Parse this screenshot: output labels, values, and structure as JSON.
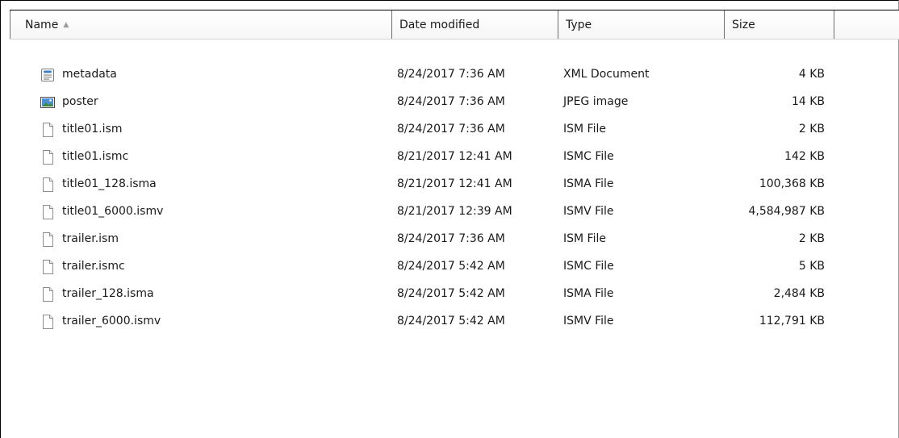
{
  "columns": {
    "name": "Name",
    "date": "Date modified",
    "type": "Type",
    "size": "Size"
  },
  "sort": {
    "column": "name",
    "direction": "ascending",
    "indicator": "▲"
  },
  "files": [
    {
      "name": "metadata",
      "date": "8/24/2017 7:36 AM",
      "type": "XML Document",
      "size": "4 KB",
      "icon": "xml-document-icon"
    },
    {
      "name": "poster",
      "date": "8/24/2017 7:36 AM",
      "type": "JPEG image",
      "size": "14 KB",
      "icon": "image-file-icon"
    },
    {
      "name": "title01.ism",
      "date": "8/24/2017 7:36 AM",
      "type": "ISM File",
      "size": "2 KB",
      "icon": "blank-file-icon"
    },
    {
      "name": "title01.ismc",
      "date": "8/21/2017 12:41 AM",
      "type": "ISMC File",
      "size": "142 KB",
      "icon": "blank-file-icon"
    },
    {
      "name": "title01_128.isma",
      "date": "8/21/2017 12:41 AM",
      "type": "ISMA File",
      "size": "100,368 KB",
      "icon": "blank-file-icon"
    },
    {
      "name": "title01_6000.ismv",
      "date": "8/21/2017 12:39 AM",
      "type": "ISMV File",
      "size": "4,584,987 KB",
      "icon": "blank-file-icon"
    },
    {
      "name": "trailer.ism",
      "date": "8/24/2017 7:36 AM",
      "type": "ISM File",
      "size": "2 KB",
      "icon": "blank-file-icon"
    },
    {
      "name": "trailer.ismc",
      "date": "8/24/2017 5:42 AM",
      "type": "ISMC File",
      "size": "5 KB",
      "icon": "blank-file-icon"
    },
    {
      "name": "trailer_128.isma",
      "date": "8/24/2017 5:42 AM",
      "type": "ISMA File",
      "size": "2,484 KB",
      "icon": "blank-file-icon"
    },
    {
      "name": "trailer_6000.ismv",
      "date": "8/24/2017 5:42 AM",
      "type": "ISMV File",
      "size": "112,791 KB",
      "icon": "blank-file-icon"
    }
  ],
  "colors": {
    "text": "#1a1a1a",
    "header_divider": "#6e6e6e",
    "sort_indicator": "#9a9a9a"
  }
}
